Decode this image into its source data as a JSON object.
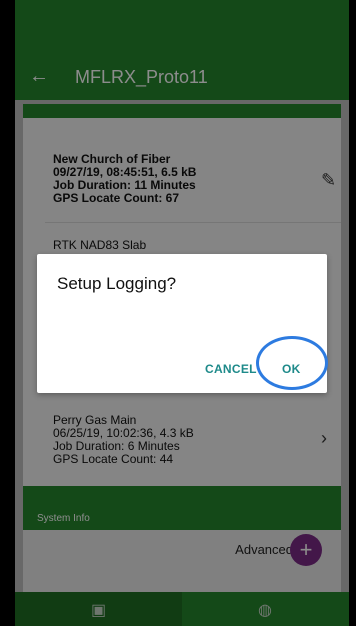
{
  "app": {
    "title": "MFLRX_Proto11",
    "back_icon": "←"
  },
  "list": [
    {
      "name": "New Church of Fiber",
      "meta": "09/27/19, 08:45:51, 6.5 kB",
      "duration": "Job Duration: 11 Minutes",
      "gps": "GPS Locate Count: 67",
      "action_icon": "✎"
    },
    {
      "name": "RTK NAD83 Slab"
    },
    {
      "name": "Perry Gas Main",
      "meta": "06/25/19, 10:02:36, 4.3 kB",
      "duration": "Job Duration: 6 Minutes",
      "gps": "GPS Locate Count: 44",
      "action_icon": "›"
    }
  ],
  "system_info_label": "System Info",
  "advanced_label": "Advanced",
  "fab_icon": "+",
  "dialog": {
    "title": "Setup Logging?",
    "cancel_label": "CANCEL",
    "ok_label": "OK"
  },
  "nav": {
    "left_icon": "▣",
    "right_icon": "◍"
  }
}
